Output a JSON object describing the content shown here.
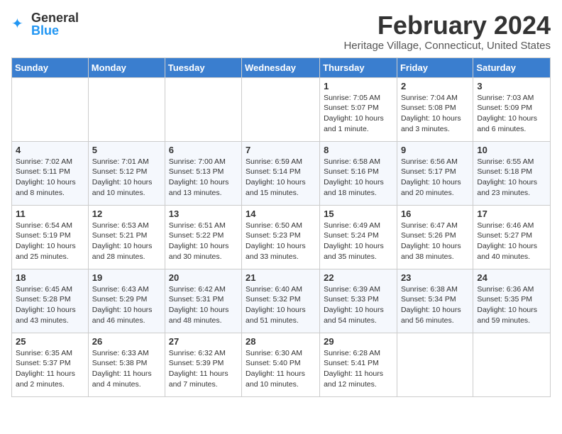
{
  "header": {
    "logo_general": "General",
    "logo_blue": "Blue",
    "title": "February 2024",
    "location": "Heritage Village, Connecticut, United States"
  },
  "days_of_week": [
    "Sunday",
    "Monday",
    "Tuesday",
    "Wednesday",
    "Thursday",
    "Friday",
    "Saturday"
  ],
  "weeks": [
    [
      {
        "day": "",
        "info": ""
      },
      {
        "day": "",
        "info": ""
      },
      {
        "day": "",
        "info": ""
      },
      {
        "day": "",
        "info": ""
      },
      {
        "day": "1",
        "info": "Sunrise: 7:05 AM\nSunset: 5:07 PM\nDaylight: 10 hours\nand 1 minute."
      },
      {
        "day": "2",
        "info": "Sunrise: 7:04 AM\nSunset: 5:08 PM\nDaylight: 10 hours\nand 3 minutes."
      },
      {
        "day": "3",
        "info": "Sunrise: 7:03 AM\nSunset: 5:09 PM\nDaylight: 10 hours\nand 6 minutes."
      }
    ],
    [
      {
        "day": "4",
        "info": "Sunrise: 7:02 AM\nSunset: 5:11 PM\nDaylight: 10 hours\nand 8 minutes."
      },
      {
        "day": "5",
        "info": "Sunrise: 7:01 AM\nSunset: 5:12 PM\nDaylight: 10 hours\nand 10 minutes."
      },
      {
        "day": "6",
        "info": "Sunrise: 7:00 AM\nSunset: 5:13 PM\nDaylight: 10 hours\nand 13 minutes."
      },
      {
        "day": "7",
        "info": "Sunrise: 6:59 AM\nSunset: 5:14 PM\nDaylight: 10 hours\nand 15 minutes."
      },
      {
        "day": "8",
        "info": "Sunrise: 6:58 AM\nSunset: 5:16 PM\nDaylight: 10 hours\nand 18 minutes."
      },
      {
        "day": "9",
        "info": "Sunrise: 6:56 AM\nSunset: 5:17 PM\nDaylight: 10 hours\nand 20 minutes."
      },
      {
        "day": "10",
        "info": "Sunrise: 6:55 AM\nSunset: 5:18 PM\nDaylight: 10 hours\nand 23 minutes."
      }
    ],
    [
      {
        "day": "11",
        "info": "Sunrise: 6:54 AM\nSunset: 5:19 PM\nDaylight: 10 hours\nand 25 minutes."
      },
      {
        "day": "12",
        "info": "Sunrise: 6:53 AM\nSunset: 5:21 PM\nDaylight: 10 hours\nand 28 minutes."
      },
      {
        "day": "13",
        "info": "Sunrise: 6:51 AM\nSunset: 5:22 PM\nDaylight: 10 hours\nand 30 minutes."
      },
      {
        "day": "14",
        "info": "Sunrise: 6:50 AM\nSunset: 5:23 PM\nDaylight: 10 hours\nand 33 minutes."
      },
      {
        "day": "15",
        "info": "Sunrise: 6:49 AM\nSunset: 5:24 PM\nDaylight: 10 hours\nand 35 minutes."
      },
      {
        "day": "16",
        "info": "Sunrise: 6:47 AM\nSunset: 5:26 PM\nDaylight: 10 hours\nand 38 minutes."
      },
      {
        "day": "17",
        "info": "Sunrise: 6:46 AM\nSunset: 5:27 PM\nDaylight: 10 hours\nand 40 minutes."
      }
    ],
    [
      {
        "day": "18",
        "info": "Sunrise: 6:45 AM\nSunset: 5:28 PM\nDaylight: 10 hours\nand 43 minutes."
      },
      {
        "day": "19",
        "info": "Sunrise: 6:43 AM\nSunset: 5:29 PM\nDaylight: 10 hours\nand 46 minutes."
      },
      {
        "day": "20",
        "info": "Sunrise: 6:42 AM\nSunset: 5:31 PM\nDaylight: 10 hours\nand 48 minutes."
      },
      {
        "day": "21",
        "info": "Sunrise: 6:40 AM\nSunset: 5:32 PM\nDaylight: 10 hours\nand 51 minutes."
      },
      {
        "day": "22",
        "info": "Sunrise: 6:39 AM\nSunset: 5:33 PM\nDaylight: 10 hours\nand 54 minutes."
      },
      {
        "day": "23",
        "info": "Sunrise: 6:38 AM\nSunset: 5:34 PM\nDaylight: 10 hours\nand 56 minutes."
      },
      {
        "day": "24",
        "info": "Sunrise: 6:36 AM\nSunset: 5:35 PM\nDaylight: 10 hours\nand 59 minutes."
      }
    ],
    [
      {
        "day": "25",
        "info": "Sunrise: 6:35 AM\nSunset: 5:37 PM\nDaylight: 11 hours\nand 2 minutes."
      },
      {
        "day": "26",
        "info": "Sunrise: 6:33 AM\nSunset: 5:38 PM\nDaylight: 11 hours\nand 4 minutes."
      },
      {
        "day": "27",
        "info": "Sunrise: 6:32 AM\nSunset: 5:39 PM\nDaylight: 11 hours\nand 7 minutes."
      },
      {
        "day": "28",
        "info": "Sunrise: 6:30 AM\nSunset: 5:40 PM\nDaylight: 11 hours\nand 10 minutes."
      },
      {
        "day": "29",
        "info": "Sunrise: 6:28 AM\nSunset: 5:41 PM\nDaylight: 11 hours\nand 12 minutes."
      },
      {
        "day": "",
        "info": ""
      },
      {
        "day": "",
        "info": ""
      }
    ]
  ]
}
